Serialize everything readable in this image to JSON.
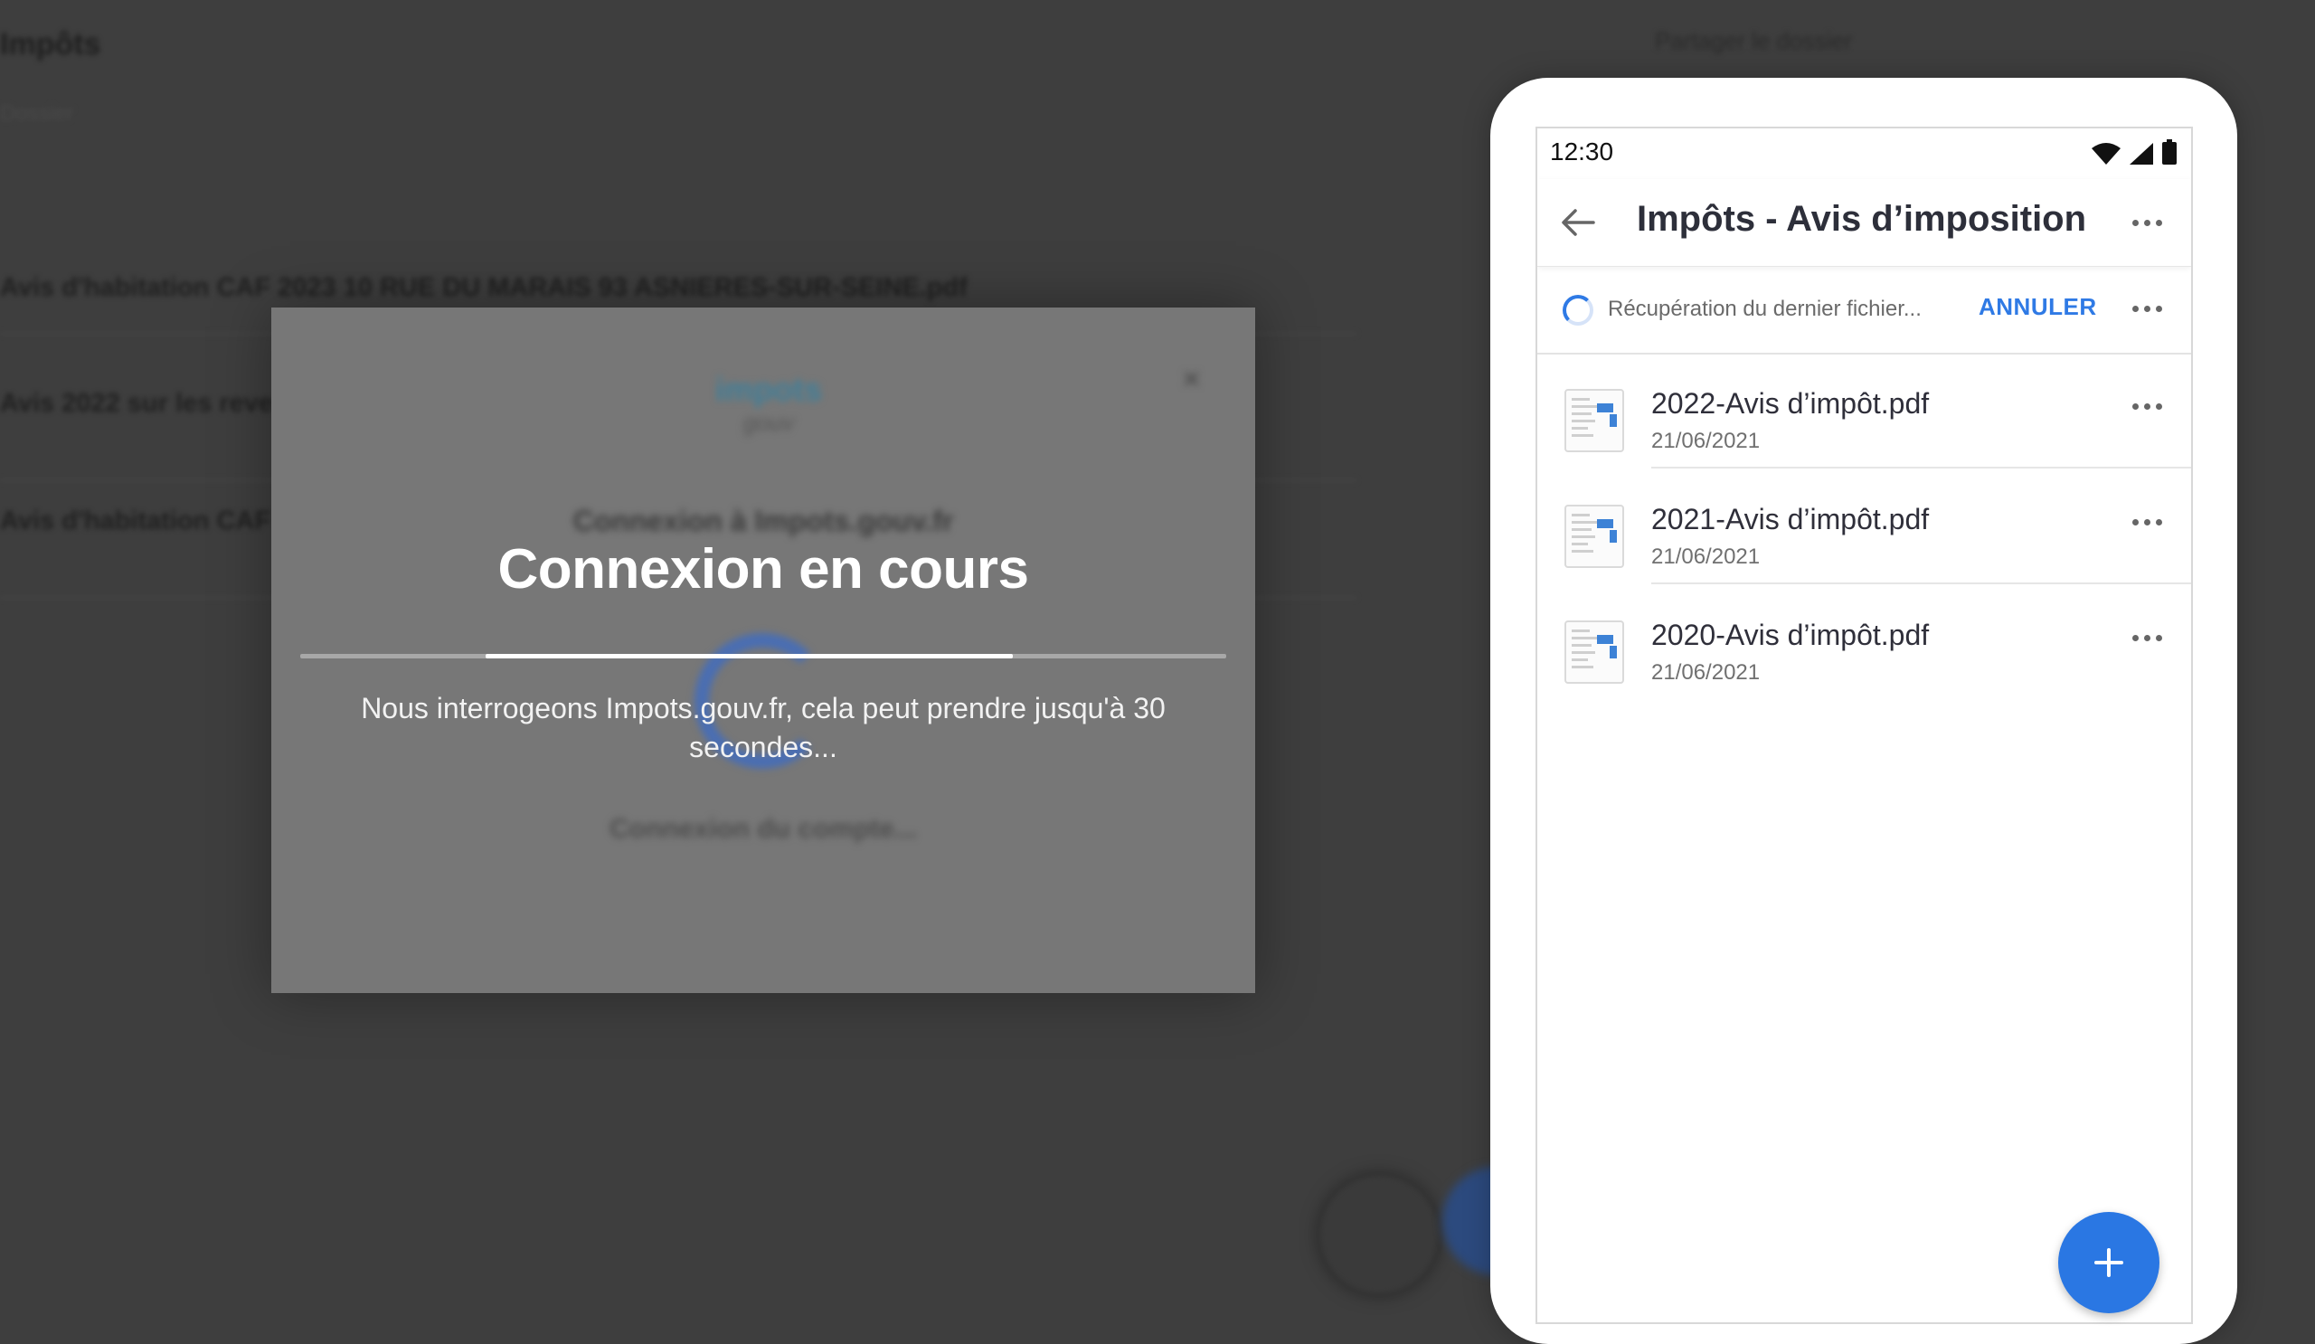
{
  "background": {
    "title": "Impôts",
    "subtitle": "Dossier",
    "header_right": "Partager le dossier",
    "rows": [
      "Avis d'habitation CAF 2023 10 RUE DU MARAIS 93 ASNIERES-SUR-SEINE.pdf",
      "Avis 2022 sur les revenus",
      "Avis d'habitation CAF"
    ]
  },
  "dialog": {
    "logo_main": "impots",
    "logo_sub": "gouv",
    "close_label": "×",
    "title": "Connexion à Impots.gouv.fr",
    "status": "Connexion du compte..."
  },
  "overlay": {
    "title": "Connexion en cours",
    "progress_start_fraction": 0.2,
    "progress_end_fraction": 0.77,
    "message": "Nous interrogeons Impots.gouv.fr, cela peut prendre jusqu'à 30 secondes..."
  },
  "phone": {
    "time": "12:30",
    "status_icons": [
      "wifi-icon",
      "signal-icon",
      "battery-icon"
    ],
    "app_title": "Impôts - Avis d’imposition",
    "sync": {
      "text": "Récupération du dernier fichier...",
      "cancel": "ANNULER"
    },
    "files": [
      {
        "name": "2022-Avis d’impôt.pdf",
        "date": "21/06/2021"
      },
      {
        "name": "2021-Avis d’impôt.pdf",
        "date": "21/06/2021"
      },
      {
        "name": "2020-Avis d’impôt.pdf",
        "date": "21/06/2021"
      }
    ],
    "fab_icon": "plus-icon",
    "accent_color": "#2f7ae5"
  }
}
